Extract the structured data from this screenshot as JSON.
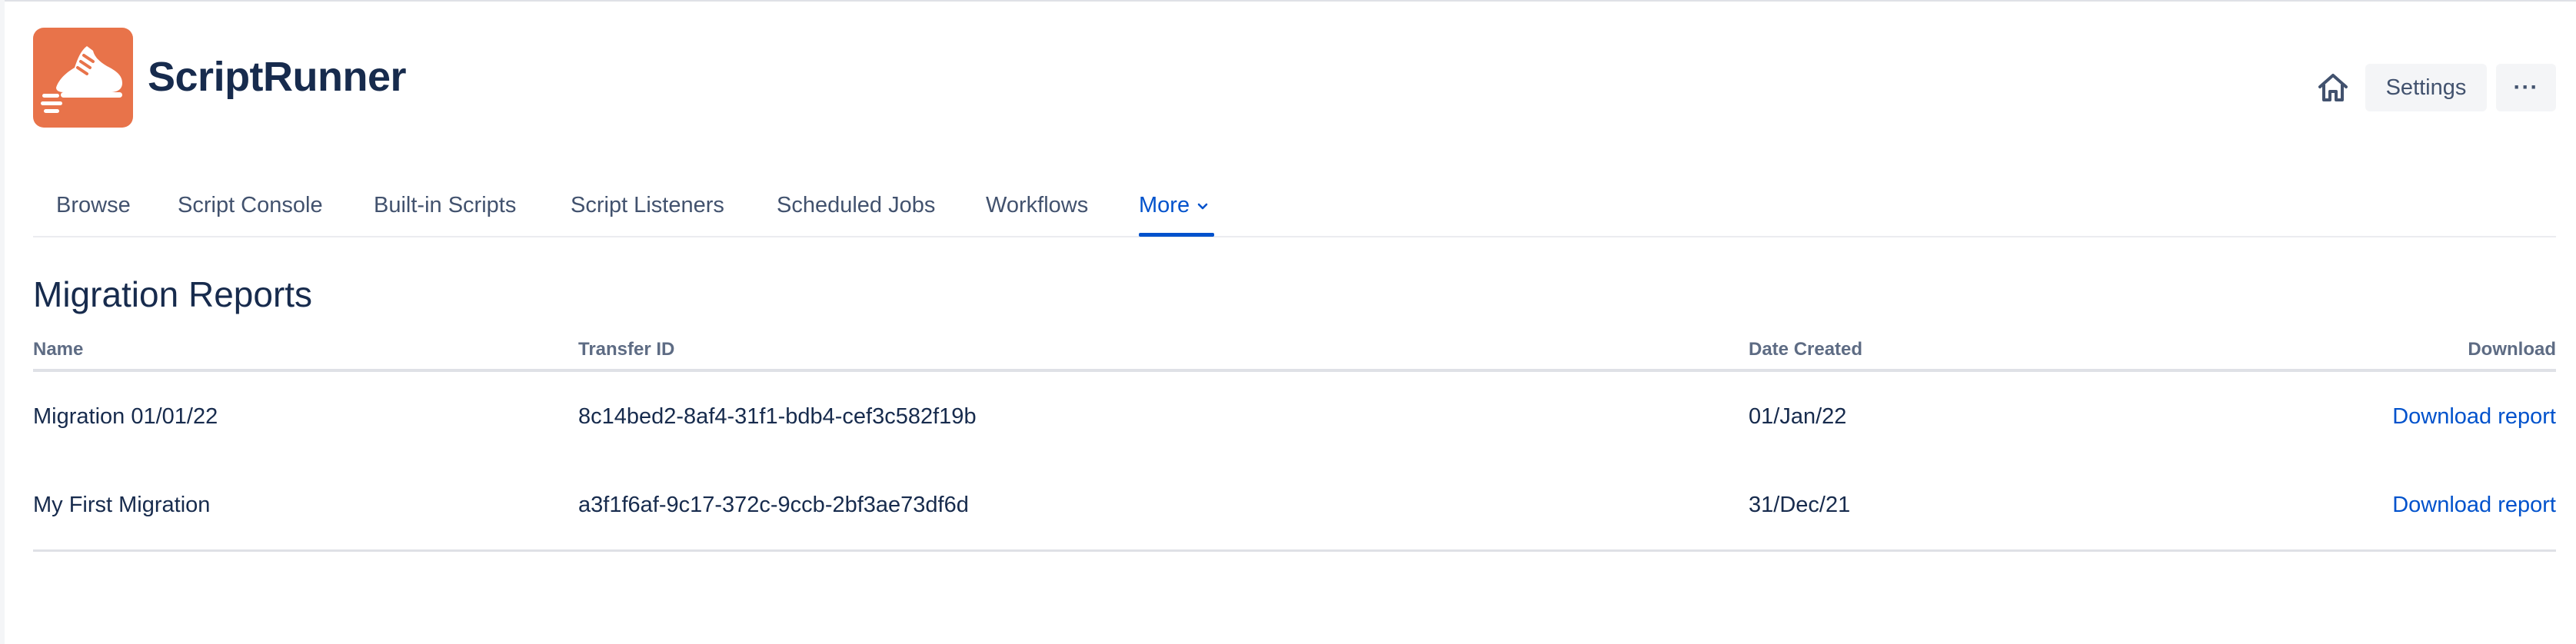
{
  "app": {
    "title": "ScriptRunner",
    "brand_color": "#e8734a",
    "logo_icon": "running-shoe-icon"
  },
  "header": {
    "home_icon": "home-icon",
    "settings_label": "Settings",
    "more_label": "···"
  },
  "nav": {
    "items": [
      {
        "label": "Browse"
      },
      {
        "label": "Script Console"
      },
      {
        "label": "Built-in Scripts"
      },
      {
        "label": "Script Listeners"
      },
      {
        "label": "Scheduled Jobs"
      },
      {
        "label": "Workflows"
      },
      {
        "label": "More",
        "active": true,
        "icon": "chevron-down-icon"
      }
    ],
    "accent_color": "#0052cc"
  },
  "main": {
    "title": "Migration Reports",
    "table": {
      "columns": [
        "Name",
        "Transfer ID",
        "Date Created",
        "Download"
      ],
      "rows": [
        {
          "name": "Migration 01/01/22",
          "transfer_id": "8c14bed2-8af4-31f1-bdb4-cef3c582f19b",
          "date_created": "01/Jan/22",
          "download": "Download report"
        },
        {
          "name": "My First Migration",
          "transfer_id": "a3f1f6af-9c17-372c-9ccb-2bf3ae73df6d",
          "date_created": "31/Dec/21",
          "download": "Download report"
        }
      ]
    }
  }
}
